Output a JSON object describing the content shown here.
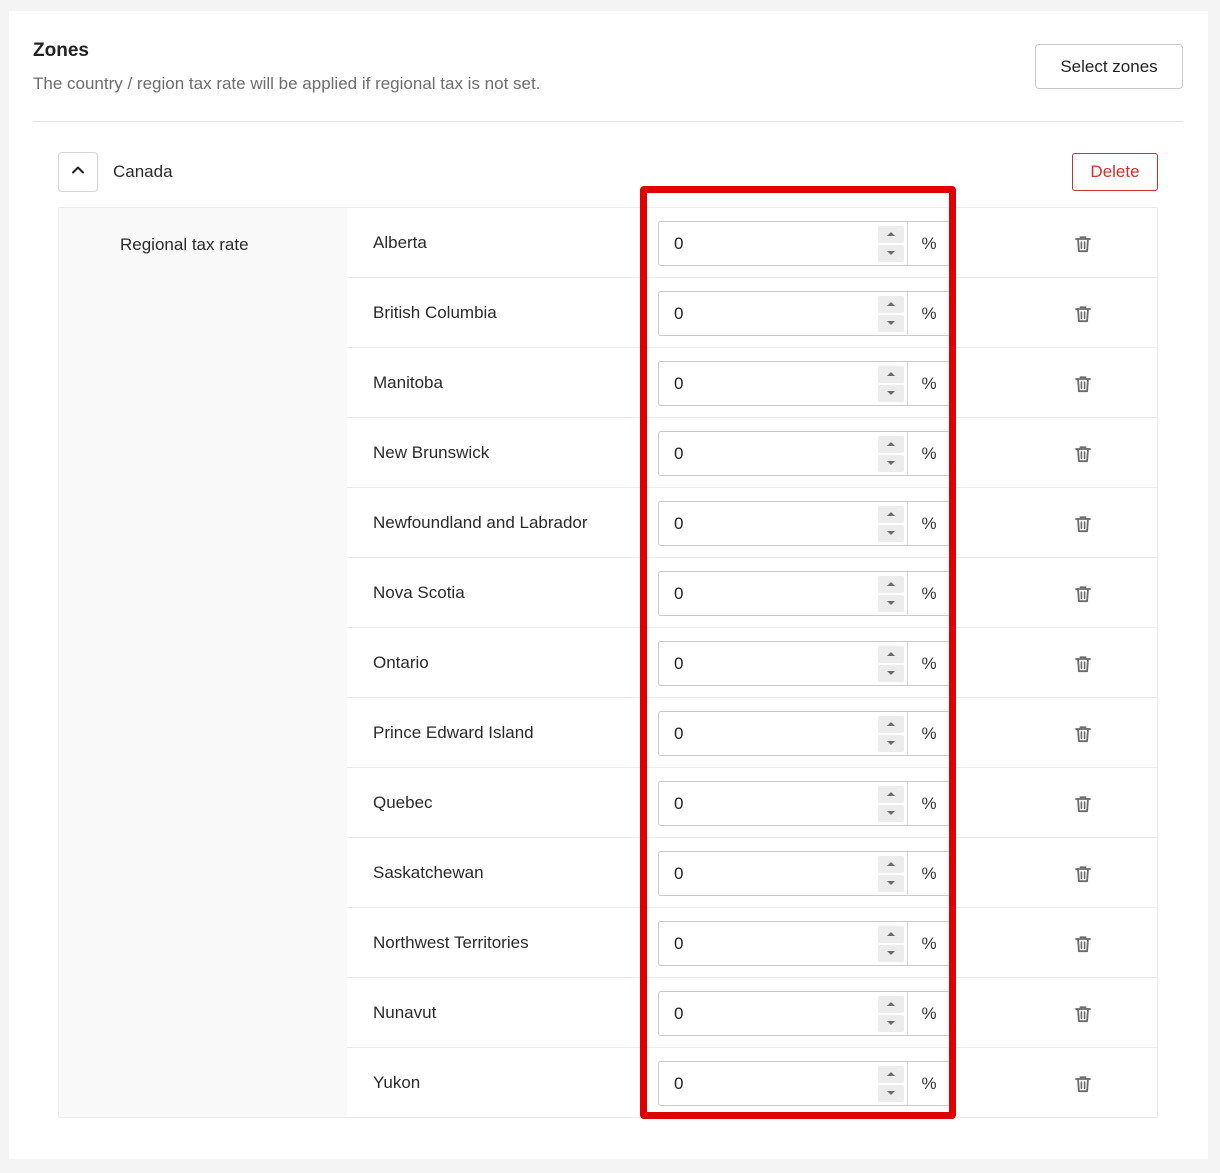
{
  "zones": {
    "title": "Zones",
    "subtitle": "The country / region tax rate will be applied if regional tax is not set.",
    "select_button": "Select zones"
  },
  "country": {
    "name": "Canada",
    "collapse_icon": "chevron-up-icon",
    "delete_label": "Delete",
    "regional_label": "Regional tax rate",
    "unit": "%",
    "provinces": [
      {
        "name": "Alberta",
        "rate": "0"
      },
      {
        "name": "British Columbia",
        "rate": "0"
      },
      {
        "name": "Manitoba",
        "rate": "0"
      },
      {
        "name": "New Brunswick",
        "rate": "0"
      },
      {
        "name": "Newfoundland and Labrador",
        "rate": "0"
      },
      {
        "name": "Nova Scotia",
        "rate": "0"
      },
      {
        "name": "Ontario",
        "rate": "0"
      },
      {
        "name": "Prince Edward Island",
        "rate": "0"
      },
      {
        "name": "Quebec",
        "rate": "0"
      },
      {
        "name": "Saskatchewan",
        "rate": "0"
      },
      {
        "name": "Northwest Territories",
        "rate": "0"
      },
      {
        "name": "Nunavut",
        "rate": "0"
      },
      {
        "name": "Yukon",
        "rate": "0"
      }
    ]
  },
  "colors": {
    "delete": "#d0312d",
    "highlight": "#e00000"
  }
}
